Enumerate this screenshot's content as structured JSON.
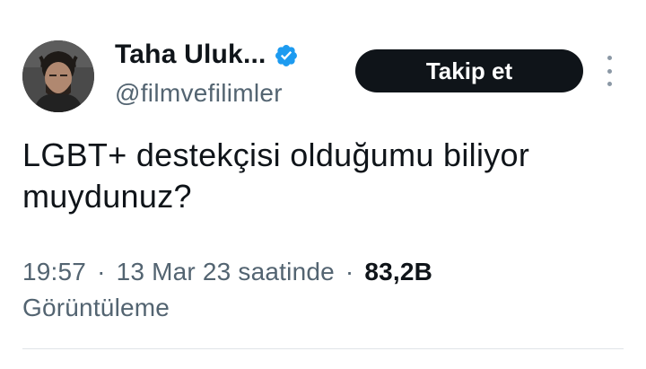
{
  "author": {
    "display_name": "Taha Uluk...",
    "handle": "@filmvefilimler",
    "verified": true,
    "avatar_icon": "profile-photo"
  },
  "follow_button": {
    "label": "Takip et"
  },
  "more_menu": {
    "icon": "more-vertical-icon"
  },
  "tweet": {
    "text_line1": "LGBT+ destekçisi olduğumu biliyor",
    "text_line2": "muydunuz?"
  },
  "meta": {
    "time": "19:57",
    "separator": "·",
    "date": "13 Mar 23 saatinde",
    "views_count": "83,2B",
    "views_label": "Görüntüleme"
  },
  "colors": {
    "text_primary": "#0f1419",
    "text_secondary": "#536471",
    "verified_blue": "#1d9bf0",
    "button_bg": "#0f1419"
  }
}
